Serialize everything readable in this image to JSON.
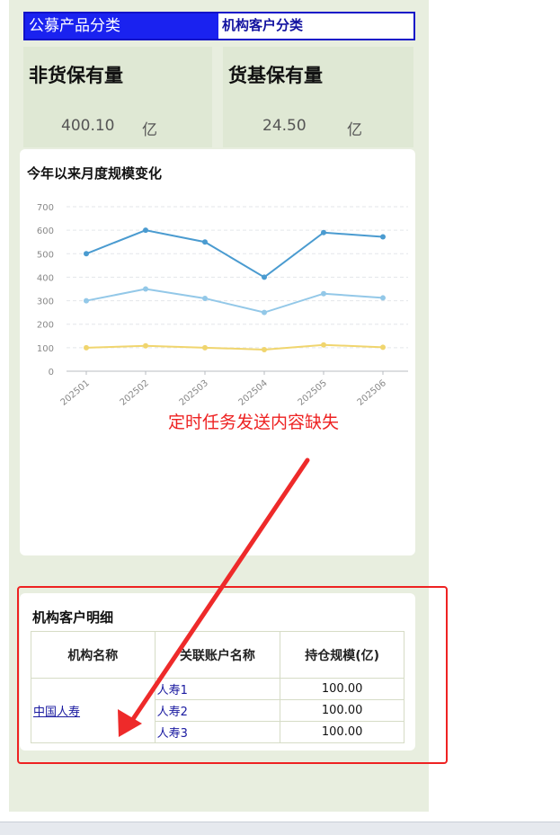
{
  "tabs": {
    "public_funds": "公募产品分类",
    "institutional": "机构客户分类"
  },
  "stats": {
    "non_money": {
      "title": "非货保有量",
      "value": "400.10",
      "unit": "亿"
    },
    "money_fund": {
      "title": "货基保有量",
      "value": "24.50",
      "unit": "亿"
    }
  },
  "chart_section": {
    "title": "今年以来月度规模变化"
  },
  "chart_data": {
    "type": "line",
    "title": "今年以来月度规模变化",
    "categories": [
      "202501",
      "202502",
      "202503",
      "202504",
      "202505",
      "202506"
    ],
    "series": [
      {
        "values": [
          500,
          600,
          550,
          400,
          590,
          572
        ],
        "color": "#4a9bd0"
      },
      {
        "values": [
          300,
          350,
          310,
          250,
          330,
          312
        ],
        "color": "#93c8e8"
      },
      {
        "values": [
          100,
          108,
          100,
          92,
          112,
          102
        ],
        "color": "#f0d56e"
      }
    ],
    "yticks": [
      "0",
      "100",
      "200",
      "300",
      "400",
      "500",
      "600",
      "700"
    ],
    "ylim": [
      0,
      700
    ],
    "grid": true
  },
  "annotation": {
    "note": "定时任务发送内容缺失",
    "color": "#ee2222"
  },
  "detail": {
    "title": "机构客户明细",
    "headers": [
      "机构名称",
      "关联账户名称",
      "持仓规模(亿)"
    ],
    "institution": "中国人寿",
    "rows": [
      {
        "account": "人寿1",
        "amount": "100.00"
      },
      {
        "account": "人寿2",
        "amount": "100.00"
      },
      {
        "account": "人寿3",
        "amount": "100.00"
      }
    ]
  }
}
